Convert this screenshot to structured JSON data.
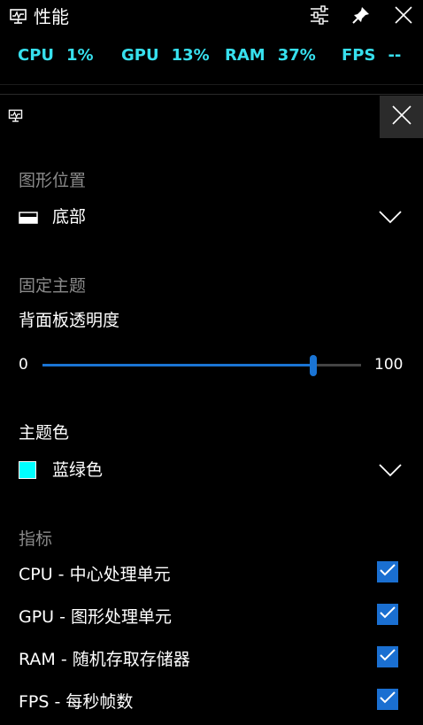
{
  "titlebar": {
    "title": "性能",
    "icons": [
      "performance-monitor-icon",
      "settings-sliders-icon",
      "pin-icon",
      "close-icon"
    ]
  },
  "metrics": [
    {
      "label": "CPU",
      "value": "1%"
    },
    {
      "label": "GPU",
      "value": "13%"
    },
    {
      "label": "RAM",
      "value": "37%"
    },
    {
      "label": "FPS",
      "value": "--"
    }
  ],
  "colors": {
    "background": "#000000",
    "metric_text": "#37e0ee",
    "accent": "#1a74d4",
    "section_label": "#8a8a8a",
    "close_button_bg": "#2b2b2b",
    "theme_swatch": "#00ffff"
  },
  "panel": {
    "graph_position": {
      "section_label": "图形位置",
      "selected": "底部",
      "icon": "bottom-position-icon"
    },
    "pin_theme": {
      "section_label": "固定主题",
      "opacity_label": "背面板透明度",
      "slider_min": "0",
      "slider_max": "100",
      "slider_value": 85
    },
    "theme_color": {
      "label": "主题色",
      "selected": "蓝绿色"
    },
    "metrics_section": {
      "section_label": "指标",
      "items": [
        {
          "label": "CPU - 中心处理单元",
          "checked": true
        },
        {
          "label": "GPU - 图形处理单元",
          "checked": true
        },
        {
          "label": "RAM - 随机存取存储器",
          "checked": true
        },
        {
          "label": "FPS - 每秒帧数",
          "checked": true
        }
      ]
    }
  }
}
